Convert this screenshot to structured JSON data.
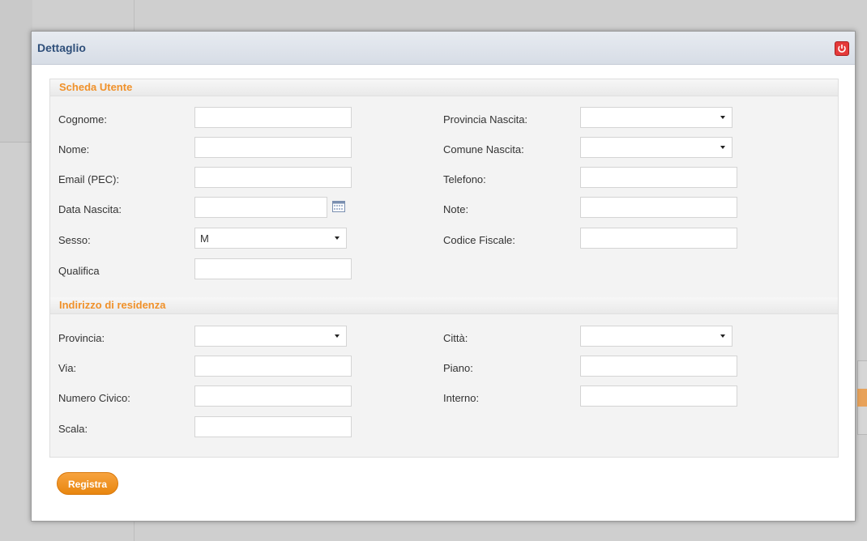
{
  "dialog": {
    "title": "Dettaglio",
    "close_icon": "power-icon",
    "accent_color": "#f0912a"
  },
  "scheda": {
    "heading": "Scheda Utente",
    "fields": {
      "cognome": {
        "label": "Cognome:",
        "value": ""
      },
      "nome": {
        "label": "Nome:",
        "value": ""
      },
      "email": {
        "label": "Email (PEC):",
        "value": ""
      },
      "data_nascita": {
        "label": "Data Nascita:",
        "value": ""
      },
      "sesso": {
        "label": "Sesso:",
        "value": "M"
      },
      "qualifica": {
        "label": "Qualifica",
        "value": ""
      },
      "provincia_nascita": {
        "label": "Provincia Nascita:",
        "value": ""
      },
      "comune_nascita": {
        "label": "Comune Nascita:",
        "value": ""
      },
      "telefono": {
        "label": "Telefono:",
        "value": ""
      },
      "note": {
        "label": "Note:",
        "value": ""
      },
      "codice_fiscale": {
        "label": "Codice Fiscale:",
        "value": ""
      }
    }
  },
  "residenza": {
    "heading": "Indirizzo di residenza",
    "fields": {
      "provincia": {
        "label": "Provincia:",
        "value": ""
      },
      "via": {
        "label": "Via:",
        "value": ""
      },
      "numero_civico": {
        "label": "Numero Civico:",
        "value": ""
      },
      "scala": {
        "label": "Scala:",
        "value": ""
      },
      "citta": {
        "label": "Città:",
        "value": ""
      },
      "piano": {
        "label": "Piano:",
        "value": ""
      },
      "interno": {
        "label": "Interno:",
        "value": ""
      }
    }
  },
  "actions": {
    "registra_label": "Registra"
  }
}
